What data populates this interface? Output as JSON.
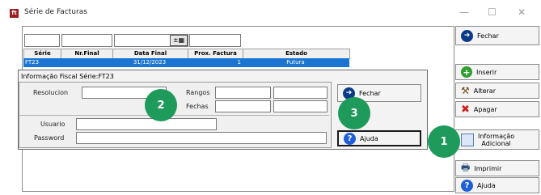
{
  "window": {
    "title": "Série de Facturas",
    "icon_glyph": "ft"
  },
  "controls": {
    "minimize": "—",
    "maximize": "☐",
    "close": "✕"
  },
  "grid": {
    "columns": [
      "Série",
      "Nr.Final",
      "Data Final",
      "Prox. Factura",
      "Estado"
    ],
    "rows": [
      {
        "serie": "FT23",
        "nr_final": "",
        "data_final": "31/12/2023",
        "prox_factura": "1",
        "estado": "Futura"
      }
    ],
    "filter_cal_icon": "±▦"
  },
  "dialog": {
    "title": "Informação Fiscal Série:FT23",
    "resolucion_label": "Resolucion",
    "rangos_label": "Rangos",
    "fechas_label": "Fechas",
    "usuario_label": "Usuario",
    "password_label": "Password",
    "fechar_label": "Fechar",
    "ajuda_label": "Ajuda"
  },
  "right_buttons": {
    "fechar": "Fechar",
    "inserir": "Inserir",
    "alterar": "Alterar",
    "apagar": "Apagar",
    "info_line1": "Informação",
    "info_line2": "Adicional",
    "imprimir": "Imprimir",
    "ajuda": "Ajuda"
  },
  "badges": [
    "1",
    "2",
    "3"
  ],
  "colors": {
    "selection": "#1a75d2",
    "badge": "#1e9a5a",
    "icon_blue": "#0b3a86"
  }
}
